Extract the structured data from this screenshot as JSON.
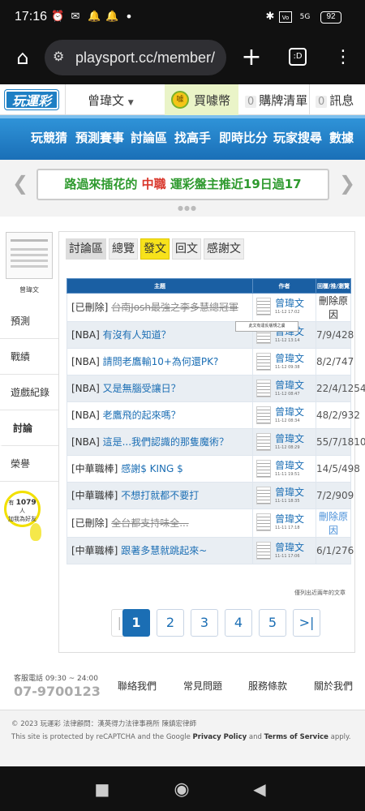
{
  "status": {
    "time": "17:16",
    "battery": "92",
    "signal": "5G"
  },
  "browser": {
    "url": "playsport.cc/member/"
  },
  "site": {
    "logo": "玩運彩",
    "username": "曾瑋文",
    "coins_label": "買噱幣",
    "coin_icon_text": "噱",
    "cart_count": "0",
    "cart_label": "購牌清單",
    "msg_count": "0",
    "msg_label": "訊息"
  },
  "nav": [
    "玩競猜",
    "預測賽事",
    "討論區",
    "找高手",
    "即時比分",
    "玩家搜尋",
    "數據"
  ],
  "banner": {
    "part1": "路過來插花的",
    "part2": "中職",
    "part3": "運彩盤主推近19日過17"
  },
  "sidebar": {
    "avatar_name": "曾瑋文",
    "items": [
      "預測",
      "戰績",
      "遊戲紀錄",
      "討論",
      "榮譽"
    ],
    "promo": {
      "prefix": "有",
      "count": "1079",
      "suffix": "人",
      "line2": "加我為好友"
    }
  },
  "tabs": [
    "討論區",
    "總覽",
    "發文",
    "回文",
    "感謝文"
  ],
  "table": {
    "headers": [
      "主題",
      "作者",
      "回覆/推/瀏覽"
    ],
    "rows": [
      {
        "prefix": "[已刪除]",
        "title": "台南Josh最強之李多慧總冠軍",
        "deleted": true,
        "author": "曾瑋文",
        "date": "11-12 17:02",
        "stat": "刪除原因",
        "stat_type": "note"
      },
      {
        "prefix": "[NBA]",
        "title": "有沒有人知道？",
        "deleted": false,
        "author": "曾瑋文",
        "date": "11-12 13:14",
        "stat": "7/9/428",
        "stat_type": "num"
      },
      {
        "prefix": "[NBA]",
        "title": "請問老鷹輸10+為何還PK?",
        "deleted": false,
        "author": "曾瑋文",
        "date": "11-12 09:38",
        "stat": "8/2/747",
        "stat_type": "num"
      },
      {
        "prefix": "[NBA]",
        "title": "又是無腦受讓日？",
        "deleted": false,
        "author": "曾瑋文",
        "date": "11-12 08:47",
        "stat": "22/4/1254",
        "stat_type": "num"
      },
      {
        "prefix": "[NBA]",
        "title": "老鷹飛的起來嗎？",
        "deleted": false,
        "author": "曾瑋文",
        "date": "11-12 08:34",
        "stat": "48/2/932",
        "stat_type": "num"
      },
      {
        "prefix": "[NBA]",
        "title": "這是...我們認識的那隻魔術？",
        "deleted": false,
        "author": "曾瑋文",
        "date": "11-12 08:29",
        "stat": "55/7/1810",
        "stat_type": "num"
      },
      {
        "prefix": "[中華職棒]",
        "title": "感謝$ KING $",
        "deleted": false,
        "author": "曾瑋文",
        "date": "11-11 19:51",
        "stat": "14/5/498",
        "stat_type": "num"
      },
      {
        "prefix": "[中華職棒]",
        "title": "不想打就都不要打",
        "deleted": false,
        "author": "曾瑋文",
        "date": "11-11 18:35",
        "stat": "7/2/909",
        "stat_type": "num"
      },
      {
        "prefix": "[已刪除]",
        "title": "全台都支持味全...",
        "deleted": true,
        "author": "曾瑋文",
        "date": "11-11 17:18",
        "stat": "刪除原因",
        "stat_type": "link"
      },
      {
        "prefix": "[中華職棒]",
        "title": "跟著多慧就跳起來~",
        "deleted": false,
        "author": "曾瑋文",
        "date": "11-11 17:06",
        "stat": "6/1/276",
        "stat_type": "num"
      }
    ]
  },
  "tooltip": "此文有違反版規之虞",
  "note": "僅列出近兩年的文章",
  "pagination": {
    "first": "|<",
    "pages": [
      "1",
      "2",
      "3",
      "4",
      "5"
    ],
    "last": ">|",
    "current": "1"
  },
  "footer": {
    "hours": "客服電話 09:30 ~ 24:00",
    "phone": "07-9700123",
    "links": [
      "聯絡我們",
      "常見問題",
      "服務條款",
      "關於我們"
    ],
    "copyright": "© 2023 玩運彩 法律顧問：漢英得力法律事務所 陳鎮宏律師",
    "recaptcha_pre": "This site is protected by reCAPTCHA and the Google",
    "privacy": "Privacy Policy",
    "and": "and",
    "terms": "Terms of Service",
    "apply": "apply."
  },
  "colors": {
    "brand_blue": "#1a6fb7",
    "link": "#1b6eb4",
    "active_tab": "#f7e21b",
    "banner_green": "#2e9a2e",
    "banner_red": "#d9362b"
  }
}
